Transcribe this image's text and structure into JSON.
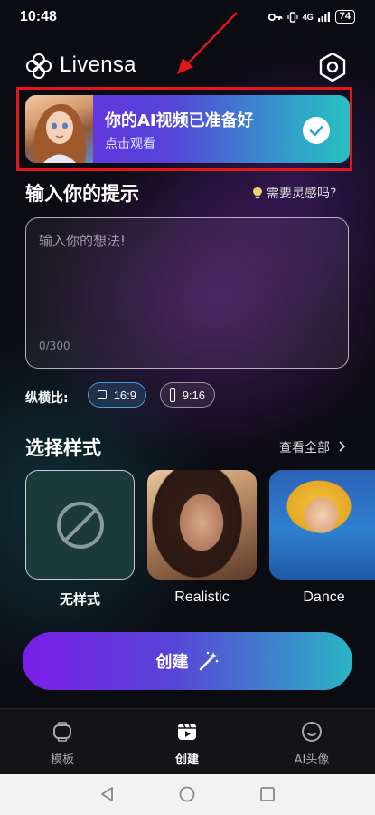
{
  "status_bar": {
    "time": "10:48",
    "network": "4G",
    "battery": "74"
  },
  "header": {
    "app_name": "Livensa"
  },
  "banner": {
    "title": "你的AI视频已准备好",
    "subtitle": "点击观看"
  },
  "prompt": {
    "title": "输入你的提示",
    "inspiration_link": "需要灵感吗?",
    "placeholder": "输入你的想法!",
    "char_count": "0/300"
  },
  "aspect_ratio": {
    "label": "纵横比:",
    "options": [
      "16:9",
      "9:16"
    ],
    "selected": "16:9"
  },
  "styles": {
    "title": "选择样式",
    "view_all": "查看全部",
    "items": [
      {
        "label": "无样式"
      },
      {
        "label": "Realistic"
      },
      {
        "label": "Dance"
      }
    ]
  },
  "create_button": {
    "label": "创建"
  },
  "bottom_nav": {
    "items": [
      {
        "label": "模板"
      },
      {
        "label": "创建"
      },
      {
        "label": "AI头像"
      }
    ],
    "active": "创建"
  },
  "colors": {
    "accent_purple": "#7b1ee8",
    "accent_teal": "#2bb3c6",
    "highlight_red": "#e3161c"
  }
}
